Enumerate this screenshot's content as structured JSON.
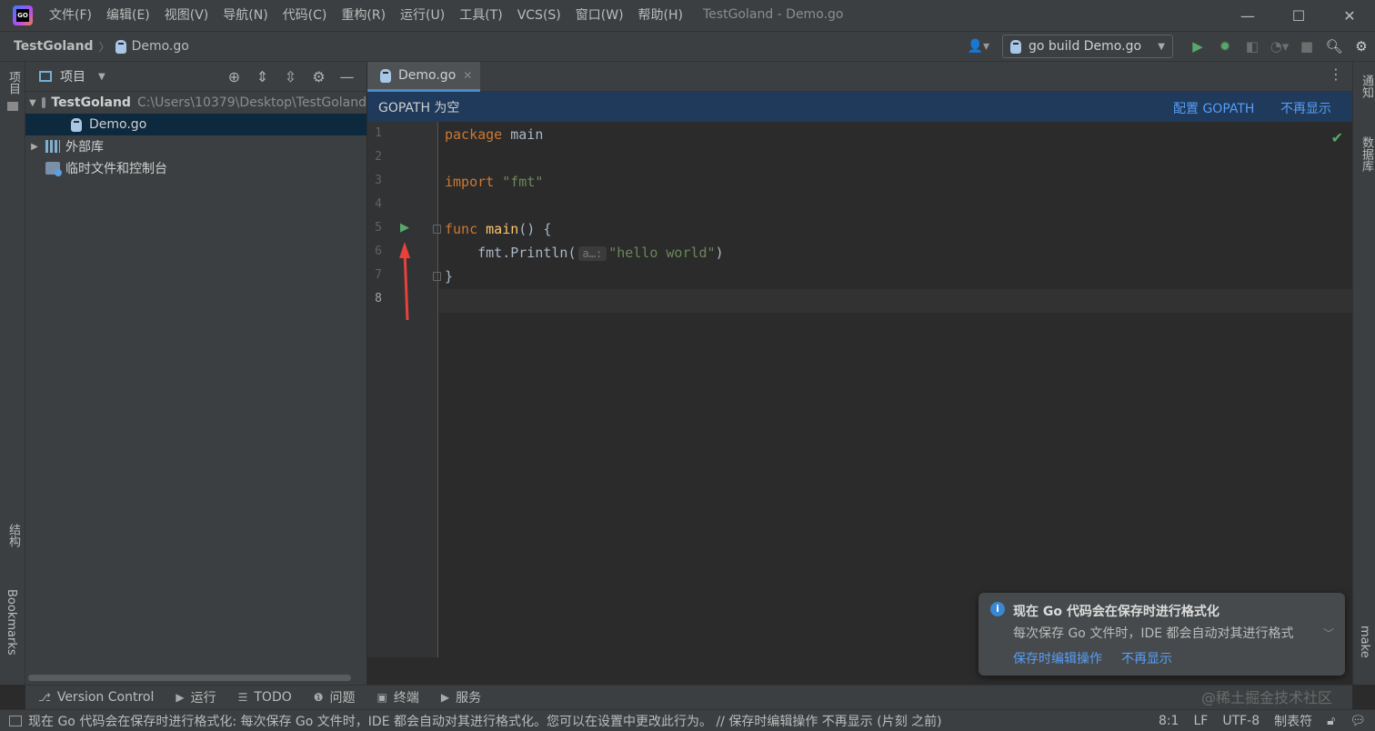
{
  "titlebar": {
    "logo": "GO",
    "menu": [
      "文件(F)",
      "编辑(E)",
      "视图(V)",
      "导航(N)",
      "代码(C)",
      "重构(R)",
      "运行(U)",
      "工具(T)",
      "VCS(S)",
      "窗口(W)",
      "帮助(H)"
    ],
    "window_title": "TestGoland - Demo.go"
  },
  "navbar": {
    "project": "TestGoland",
    "file": "Demo.go",
    "run_config": "go build Demo.go"
  },
  "left_strip": {
    "project_tab": "项目",
    "structure_tab": "结构",
    "bookmarks_tab": "Bookmarks"
  },
  "right_strip": {
    "notifications_tab": "通知",
    "database_tab": "数据库",
    "make_tab": "make"
  },
  "project_panel": {
    "title": "项目",
    "tree": {
      "root_name": "TestGoland",
      "root_path": "C:\\Users\\10379\\Desktop\\TestGoland",
      "file": "Demo.go",
      "external_libs": "外部库",
      "scratches": "临时文件和控制台"
    }
  },
  "editor": {
    "tab_label": "Demo.go",
    "banner": {
      "message": "GOPATH 为空",
      "configure_link": "配置 GOPATH",
      "dismiss_link": "不再显示"
    },
    "line_numbers": [
      "1",
      "2",
      "3",
      "4",
      "5",
      "6",
      "7",
      "8"
    ],
    "code": {
      "l1_kw": "package",
      "l1_rest": " main",
      "l3_kw": "import",
      "l3_str": "\"fmt\"",
      "l5_kw": "func",
      "l5_fn": "main",
      "l5_rest": "() {",
      "l6_call": "fmt.Println(",
      "l6_hint": "a…:",
      "l6_str": "\"hello world\"",
      "l6_close": ")",
      "l7": "}"
    }
  },
  "notification": {
    "title": "现在 Go 代码会在保存时进行格式化",
    "body": "每次保存 Go 文件时，IDE 都会自动对其进行格式",
    "action_link": "保存时编辑操作",
    "dismiss_link": "不再显示"
  },
  "toolwindows": [
    {
      "icon": "⎇",
      "label": "Version Control"
    },
    {
      "icon": "▶",
      "label": "运行"
    },
    {
      "icon": "☰",
      "label": "TODO"
    },
    {
      "icon": "❶",
      "label": "问题"
    },
    {
      "icon": "▣",
      "label": "终端"
    },
    {
      "icon": "▶",
      "label": "服务"
    }
  ],
  "watermark": "@稀土掘金技术社区",
  "statusbar": {
    "message": "现在 Go 代码会在保存时进行格式化: 每次保存 Go 文件时，IDE 都会自动对其进行格式化。您可以在设置中更改此行为。 // 保存时编辑操作   不再显示 (片刻 之前)",
    "caret": "8:1",
    "line_sep": "LF",
    "encoding": "UTF-8",
    "indent": "制表符"
  },
  "colors": {
    "accent": "#4a88c7",
    "banner_bg": "#1f3a5a",
    "link": "#589df6",
    "run_green": "#59a869",
    "keyword": "#cc7832",
    "string": "#6a8759",
    "function": "#ffc66d",
    "annotation_arrow": "#e8413c"
  },
  "icons": [
    "search-icon",
    "settings-icon",
    "run-icon",
    "debug-icon",
    "stop-icon",
    "user-icon",
    "target-icon",
    "check-icon",
    "info-icon"
  ]
}
